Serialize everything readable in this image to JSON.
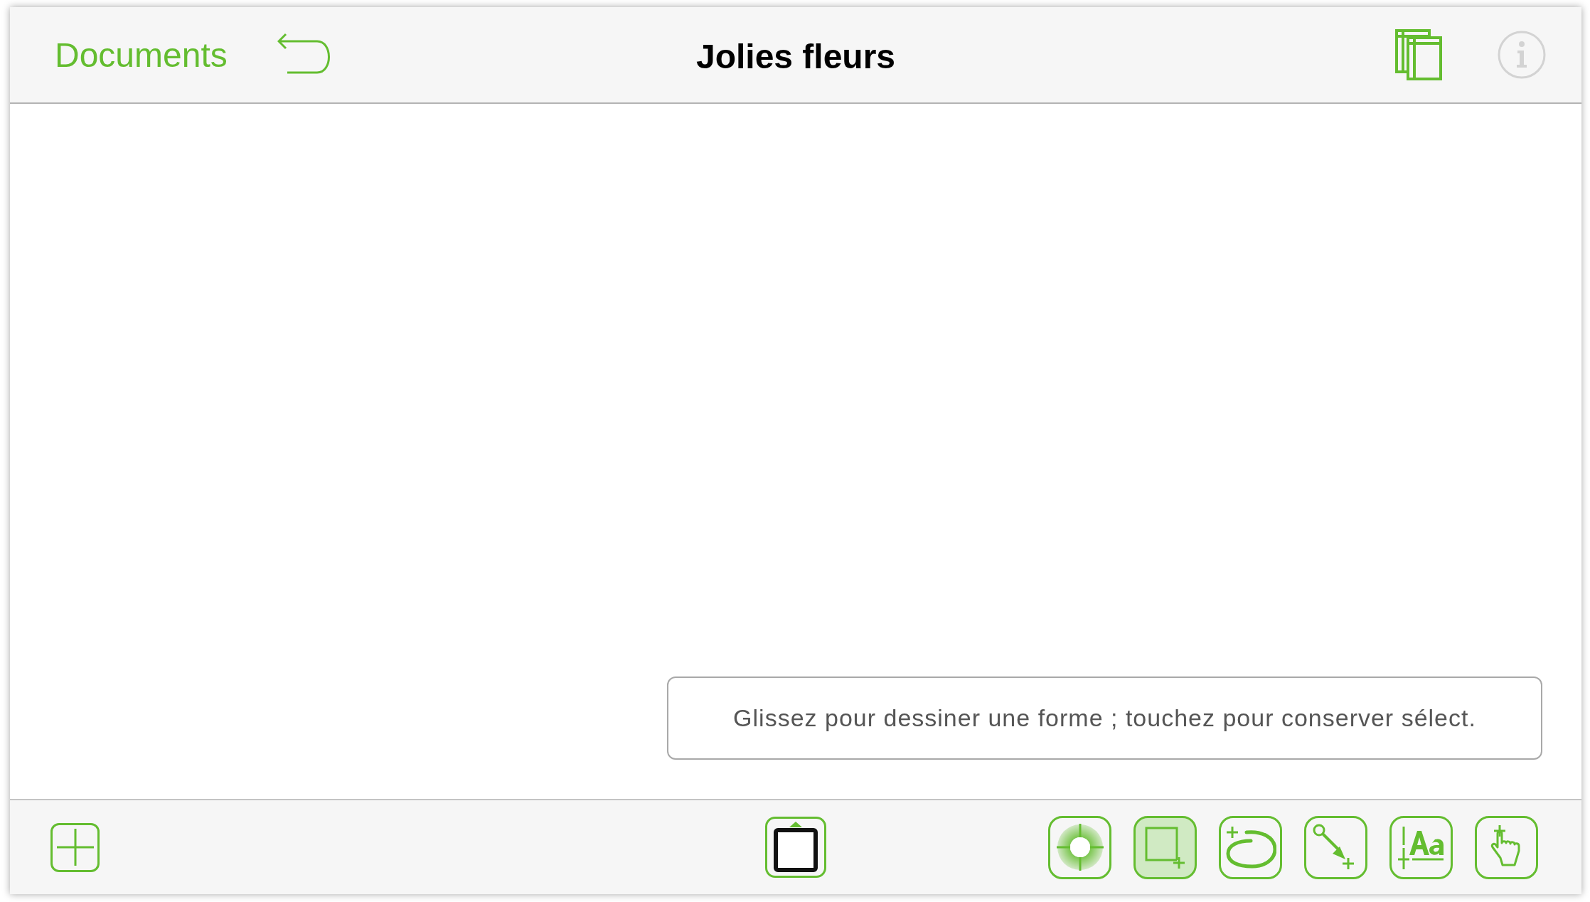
{
  "toolbar": {
    "back_label": "Documents",
    "title": "Jolies fleurs"
  },
  "hint": "Glissez pour dessiner une forme ; touchez pour conserver sélect.",
  "tools": [
    {
      "kind": "style",
      "selected": false
    },
    {
      "kind": "shape",
      "selected": true
    },
    {
      "kind": "freehand",
      "selected": false
    },
    {
      "kind": "line",
      "selected": false
    },
    {
      "kind": "text",
      "selected": false
    },
    {
      "kind": "touch",
      "selected": false
    }
  ]
}
